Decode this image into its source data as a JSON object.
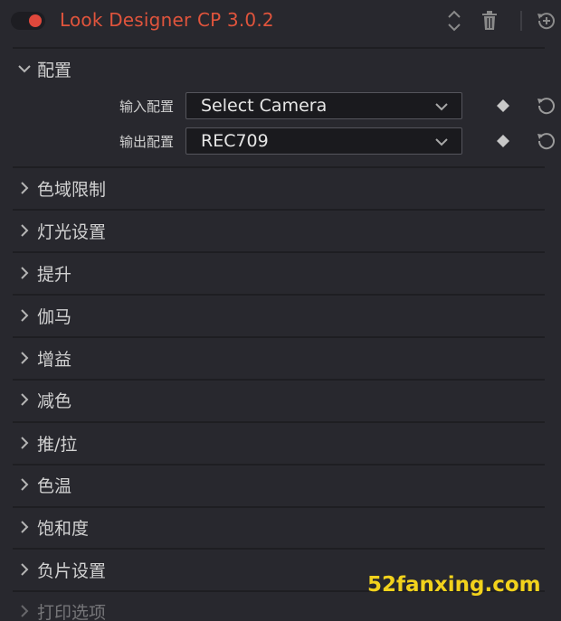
{
  "header": {
    "title": "Look Designer CP 3.0.2",
    "toggle_on": true,
    "accent_color": "#e0543c"
  },
  "config": {
    "label": "配置",
    "input_label": "输入配置",
    "input_value": "Select Camera",
    "output_label": "输出配置",
    "output_value": "REC709"
  },
  "sections": [
    "色域限制",
    "灯光设置",
    "提升",
    "伽马",
    "增益",
    "减色",
    "推/拉",
    "色温",
    "饱和度",
    "负片设置",
    "打印选项"
  ],
  "watermark": "52fanxing.com",
  "icons": {
    "sort": "up-down-chevron-icon",
    "delete": "trash-icon",
    "reset_all": "reset-plus-icon",
    "keyframe": "diamond-icon",
    "reset": "reset-icon"
  }
}
